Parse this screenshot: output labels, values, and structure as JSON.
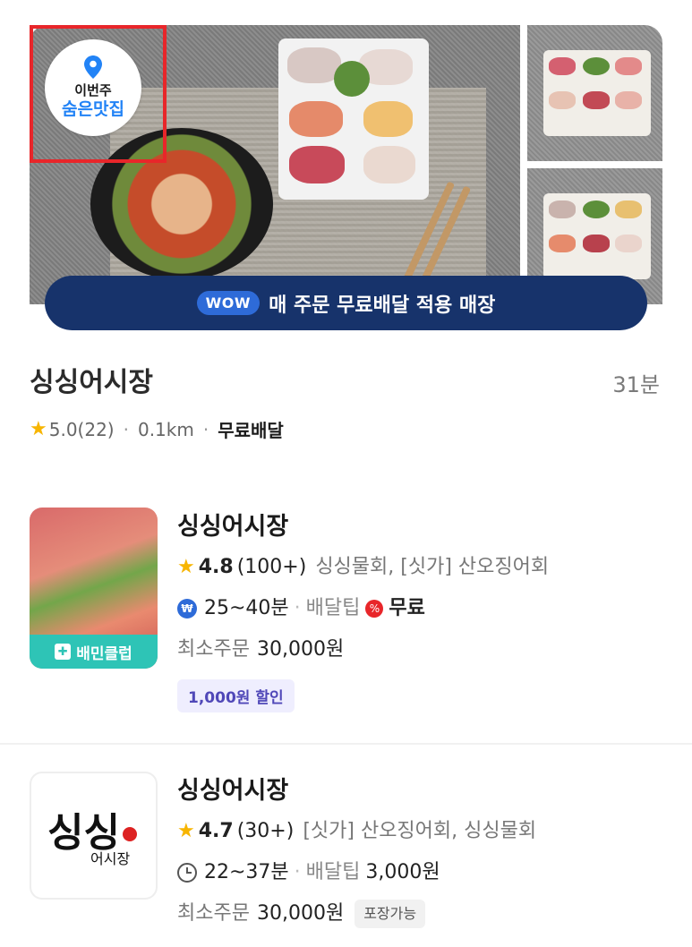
{
  "hero": {
    "badge": {
      "line1": "이번주",
      "line2": "숨은맛집",
      "pin_icon": "location-pin-icon",
      "accent": "#2283f6",
      "outline_color": "#e8262a"
    },
    "wow_banner": {
      "pill": "WOW",
      "text": "매 주문 무료배달 적용 매장",
      "bg": "#17336b"
    }
  },
  "store": {
    "name": "싱싱어시장",
    "delivery_time": "31분",
    "rating": "5.0(22)",
    "distance": "0.1km",
    "delivery_fee": "무료배달"
  },
  "cards": [
    {
      "name": "싱싱어시장",
      "rating": "4.8",
      "review_count": "(100+)",
      "menus": "싱싱물회, [싯가] 산오징어회",
      "time": "25~40분",
      "tip_label": "배달팁",
      "tip_value": "무료",
      "min_label": "최소주문",
      "min_value": "30,000원",
      "thumb_strip": "배민클럽",
      "discount": "1,000원 할인"
    },
    {
      "name": "싱싱어시장",
      "rating": "4.7",
      "review_count": "(30+)",
      "menus": "[싯가] 산오징어회, 싱싱물회",
      "time": "22~37분",
      "tip_label": "배달팁",
      "tip_value": "3,000원",
      "min_label": "최소주문",
      "min_value": "30,000원",
      "pickup": "포장가능",
      "logo_main": "싱싱",
      "logo_sub": "어시장"
    }
  ]
}
